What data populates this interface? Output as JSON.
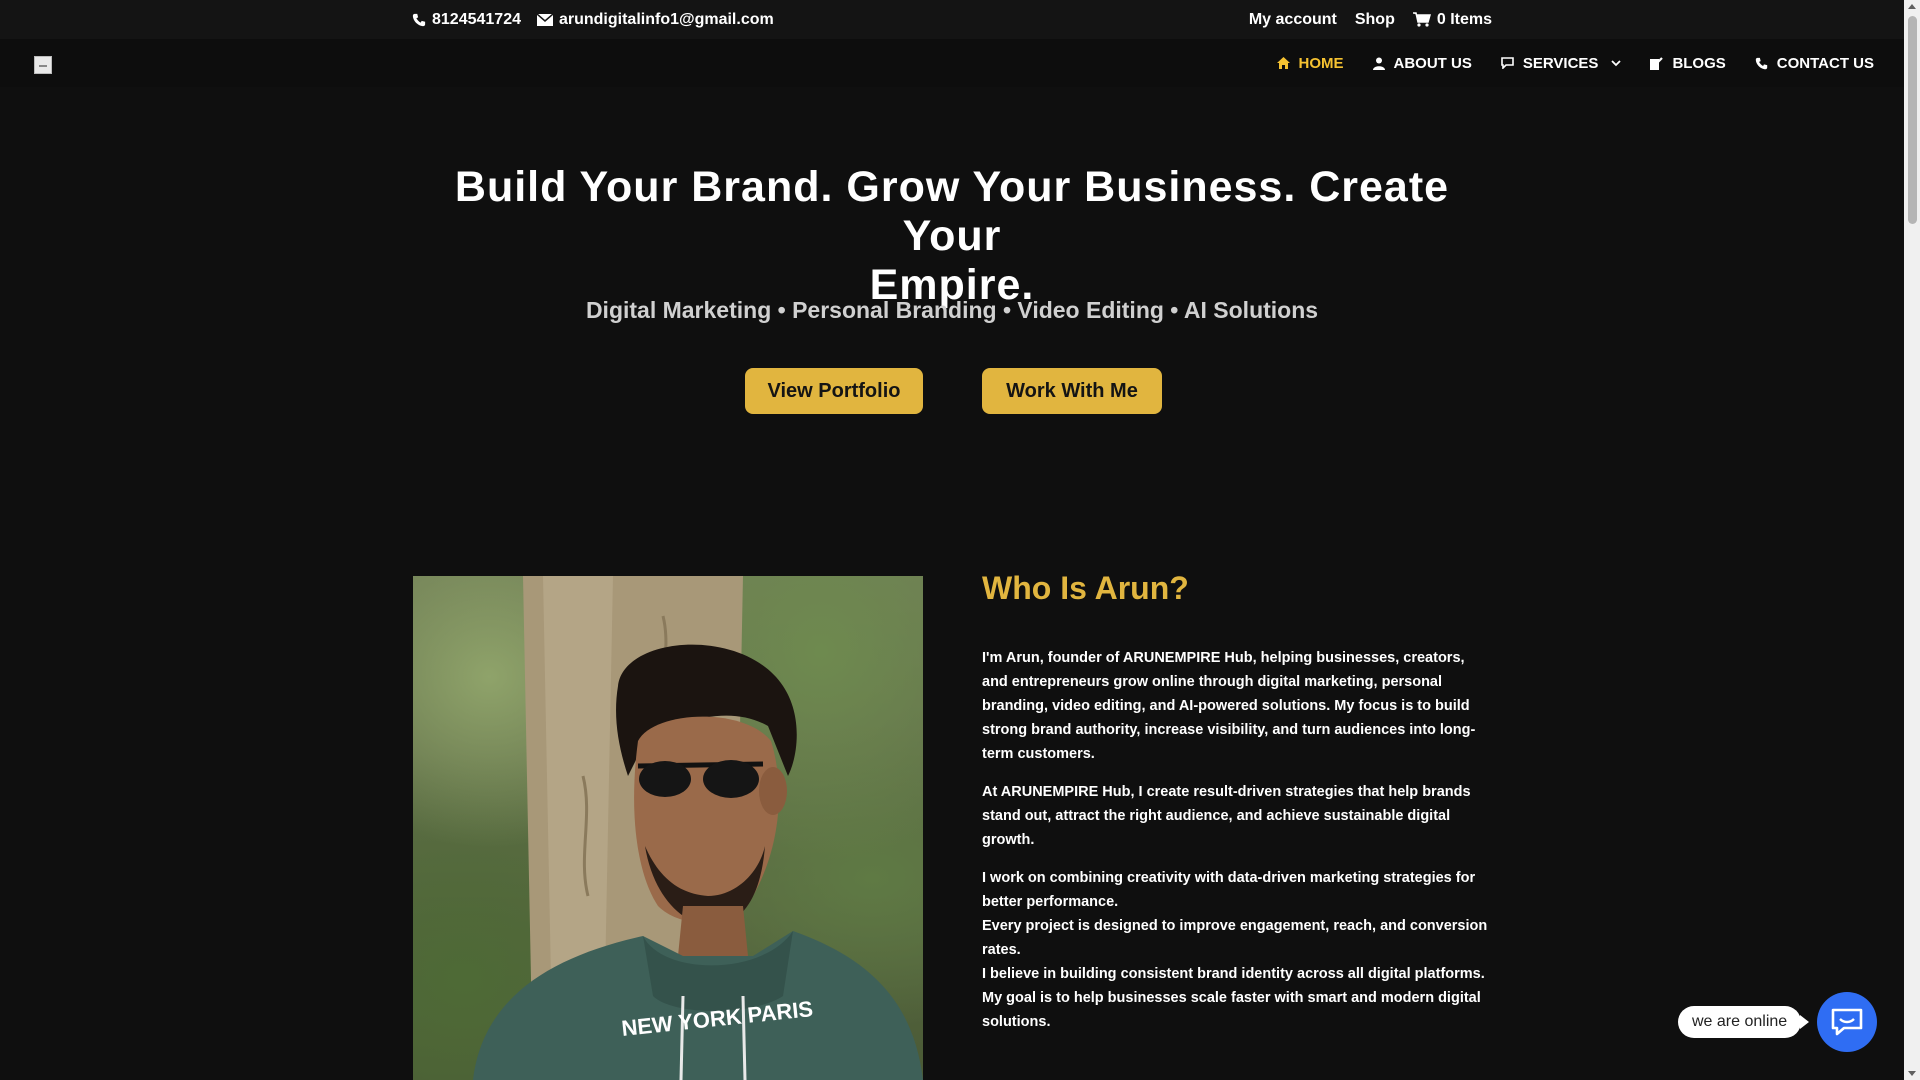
{
  "topbar": {
    "phone": "8124541724",
    "email": "arundigitalinfo1@gmail.com",
    "my_account": "My account",
    "shop": "Shop",
    "cart": "0 Items"
  },
  "nav": {
    "items": [
      {
        "label": "HOME",
        "icon": "home-icon"
      },
      {
        "label": "ABOUT US",
        "icon": "user-icon"
      },
      {
        "label": "SERVICES",
        "icon": "chat-icon"
      },
      {
        "label": "BLOGS",
        "icon": "edit-icon"
      },
      {
        "label": "CONTACT US",
        "icon": "phone-icon"
      }
    ]
  },
  "hero": {
    "title_line1": "Build Your Brand. Grow Your Business. Create Your",
    "title_line2": "Empire.",
    "subtitle": "Digital Marketing • Personal Branding • Video Editing • AI Solutions",
    "btn_portfolio": "View Portfolio",
    "btn_work": "Work With Me"
  },
  "about": {
    "heading": "Who Is Arun?",
    "p1": "I'm Arun, founder of ARUNEMPIRE Hub, helping businesses, creators, and entrepreneurs grow online through digital marketing, personal branding, video editing, and AI-powered solutions. My focus is to build strong brand authority, increase visibility, and turn audiences into long-term customers.",
    "p2": "At ARUNEMPIRE Hub, I create result-driven strategies that help brands stand out, attract the right audience, and achieve sustainable digital growth.",
    "l1": "I work on combining creativity with data-driven marketing strategies for better performance.",
    "l2": "Every project is designed to improve engagement, reach, and conversion rates.",
    "l3": "I believe in building consistent brand identity across all digital platforms.",
    "l4": "My goal is to help businesses scale faster with smart and modern digital solutions."
  },
  "photo": {
    "shirt_text": "NEW YORK PARIS"
  },
  "chat": {
    "status": "we are online"
  },
  "colors": {
    "accent": "#e1b53f",
    "active_nav": "#f5c231",
    "chat_button": "#2f6df3"
  }
}
